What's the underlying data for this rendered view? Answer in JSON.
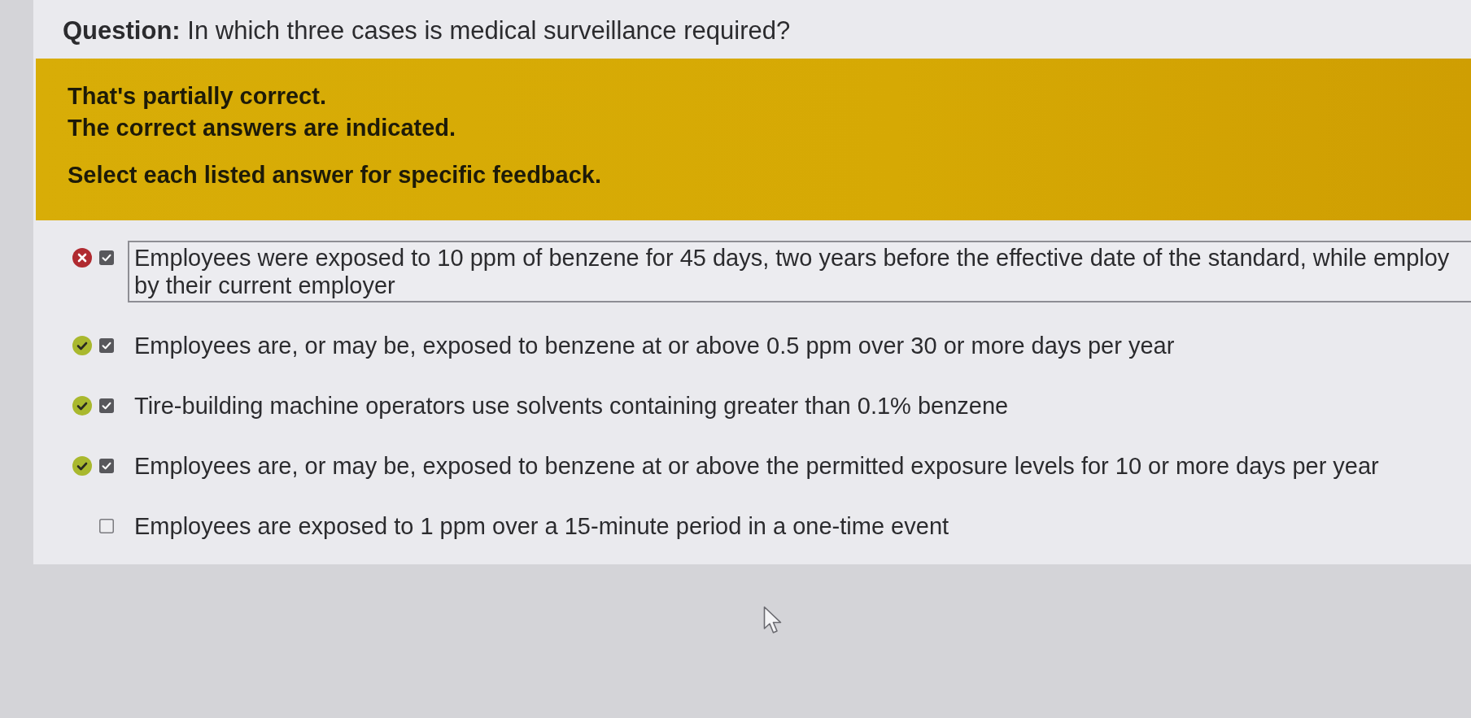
{
  "question": {
    "text": "**Question:** In which three cases is medical surveillance required?"
  },
  "feedback": {
    "paragraphs": [
      [
        "That's partially correct.",
        "The correct answers are indicated."
      ],
      [
        "Select each listed answer for specific feedback."
      ]
    ]
  },
  "answers": [
    {
      "kind": "incorrect",
      "checked": true,
      "selected": true,
      "lines": [
        "Employees were exposed to 10 ppm of benzene for 45 days, two years before the effective date of the standard, while employ",
        "by their current employer"
      ]
    },
    {
      "kind": "correct",
      "checked": true,
      "selected": false,
      "lines": [
        "Employees are, or may be, exposed to benzene at or above 0.5 ppm over 30 or more days per year"
      ]
    },
    {
      "kind": "correct",
      "checked": true,
      "selected": false,
      "lines": [
        "Tire-building machine operators use solvents containing greater than 0.1% benzene"
      ]
    },
    {
      "kind": "correct",
      "checked": true,
      "selected": false,
      "lines": [
        "Employees are, or may be, exposed to benzene at or above the permitted exposure levels for 10 or more days per year"
      ]
    },
    {
      "kind": "plain",
      "checked": false,
      "selected": false,
      "lines": [
        "Employees are exposed to 1 ppm over a 15-minute period in a one-time event"
      ]
    }
  ]
}
